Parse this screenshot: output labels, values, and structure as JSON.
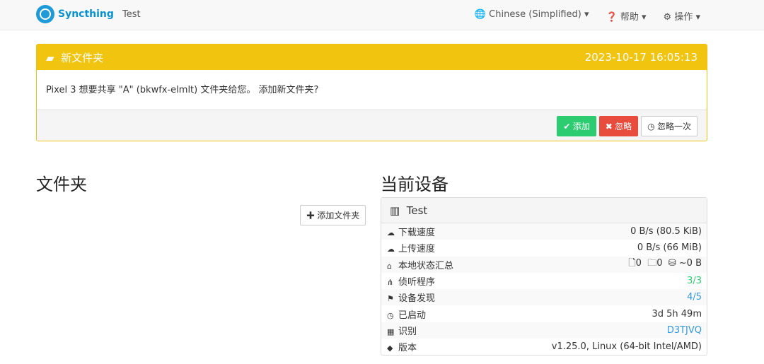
{
  "nav": {
    "brand": "Syncthing",
    "device": "Test",
    "language": "Chinese (Simplified)",
    "help": "帮助",
    "actions": "操作"
  },
  "alert": {
    "title": "新文件夹",
    "timestamp": "2023-10-17 16:05:13",
    "message": "Pixel 3 想要共享 \"A\" (bkwfx-elmlt) 文件夹给您。 添加新文件夹?",
    "add": "添加",
    "ignore": "忽略",
    "dismiss": "忽略一次"
  },
  "folders": {
    "title": "文件夹",
    "add": "添加文件夹"
  },
  "device": {
    "title": "当前设备",
    "name": "Test",
    "rows": [
      {
        "icon": "☁",
        "label": "下载速度",
        "value": "0 B/s (80.5 KiB)",
        "color": "#333"
      },
      {
        "icon": "☁",
        "label": "上传速度",
        "value": "0 B/s (66 MiB)",
        "color": "#333"
      },
      {
        "icon": "⌂",
        "label": "本地状态汇总",
        "value": "🗋0  🗀0  ⛁ ~0 B",
        "color": "#333"
      },
      {
        "icon": "⋔",
        "label": "侦听程序",
        "value": "3/3",
        "color": "#2ecc71"
      },
      {
        "icon": "⚑",
        "label": "设备发现",
        "value": "4/5",
        "color": "#3498db"
      },
      {
        "icon": "◷",
        "label": "已启动",
        "value": "3d 5h 49m",
        "color": "#333"
      },
      {
        "icon": "▦",
        "label": "识别",
        "value": "D3TJVQ",
        "color": "#3498db"
      },
      {
        "icon": "◆",
        "label": "版本",
        "value": "v1.25.0, Linux (64-bit Intel/AMD)",
        "color": "#333"
      }
    ]
  }
}
